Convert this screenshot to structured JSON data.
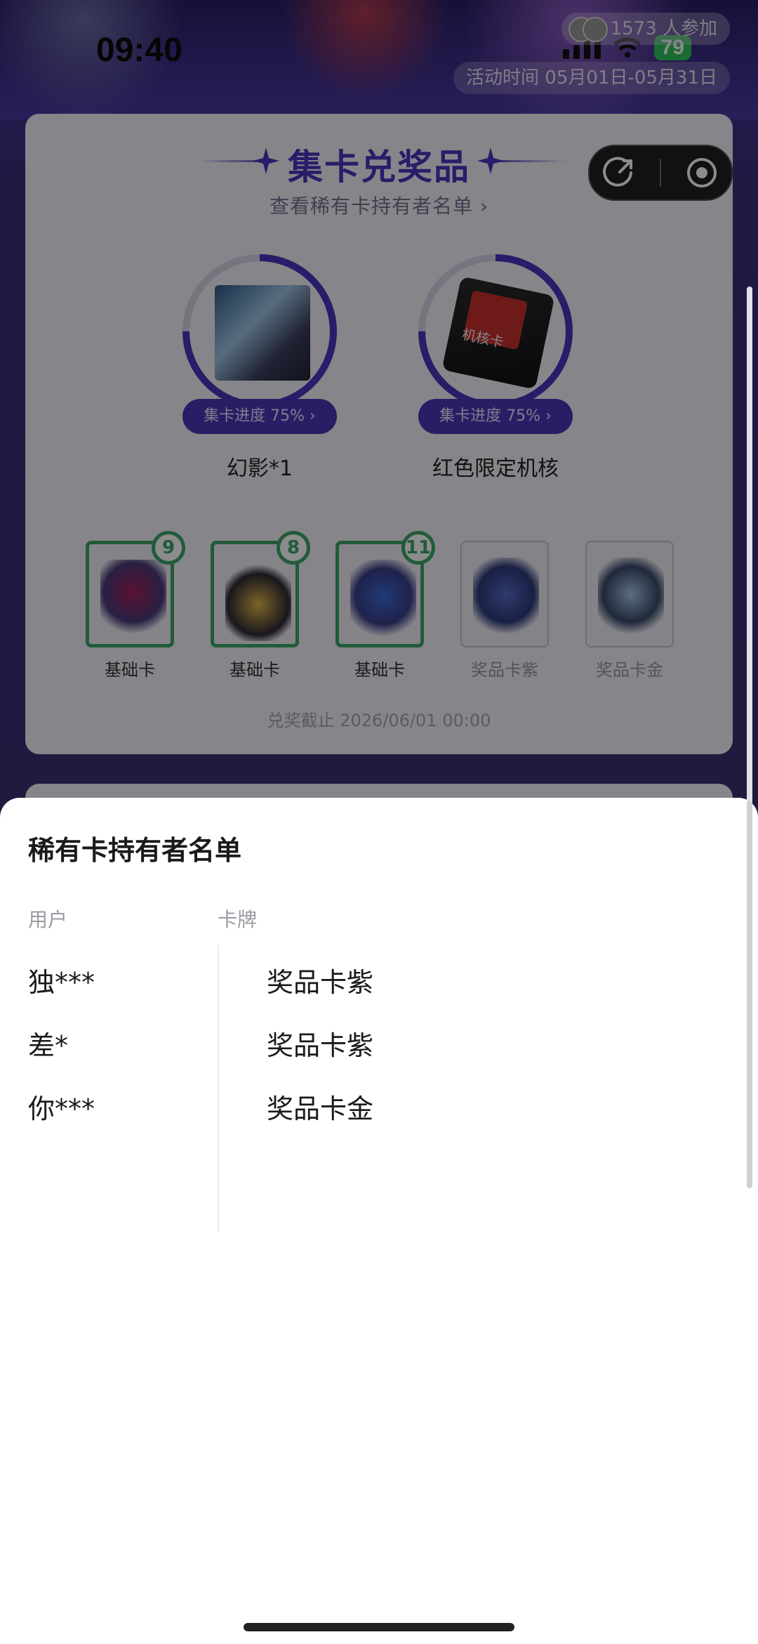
{
  "status_bar": {
    "time": "09:40",
    "battery": "79"
  },
  "banner": {
    "participants": "1573 人参加",
    "activity_time": "活动时间 05月01日-05月31日"
  },
  "collect": {
    "title": "集卡兑奖品",
    "holders_link": "查看稀有卡持有者名单 ›",
    "prizes": [
      {
        "name": "幻影*1",
        "progress_label": "集卡进度 75% ›",
        "progress": 0.75
      },
      {
        "name": "红色限定机核",
        "progress_label": "集卡进度 75% ›",
        "progress": 0.75
      }
    ],
    "prize_card_text": "机核卡",
    "cards": [
      {
        "label": "基础卡",
        "count": "9"
      },
      {
        "label": "基础卡",
        "count": "8"
      },
      {
        "label": "基础卡",
        "count": "11"
      },
      {
        "label": "奖品卡紫",
        "count": ""
      },
      {
        "label": "奖品卡金",
        "count": ""
      }
    ],
    "deadline": "兑奖截止 2026/06/01 00:00"
  },
  "sheet": {
    "title": "稀有卡持有者名单",
    "col_user": "用户",
    "col_card": "卡牌",
    "rows": [
      {
        "user": "独***",
        "card": "奖品卡紫"
      },
      {
        "user": "差*",
        "card": "奖品卡紫"
      },
      {
        "user": "你***",
        "card": "奖品卡金"
      }
    ]
  },
  "colors": {
    "accent": "#4a36c0",
    "badge_green": "#3ea66a"
  }
}
